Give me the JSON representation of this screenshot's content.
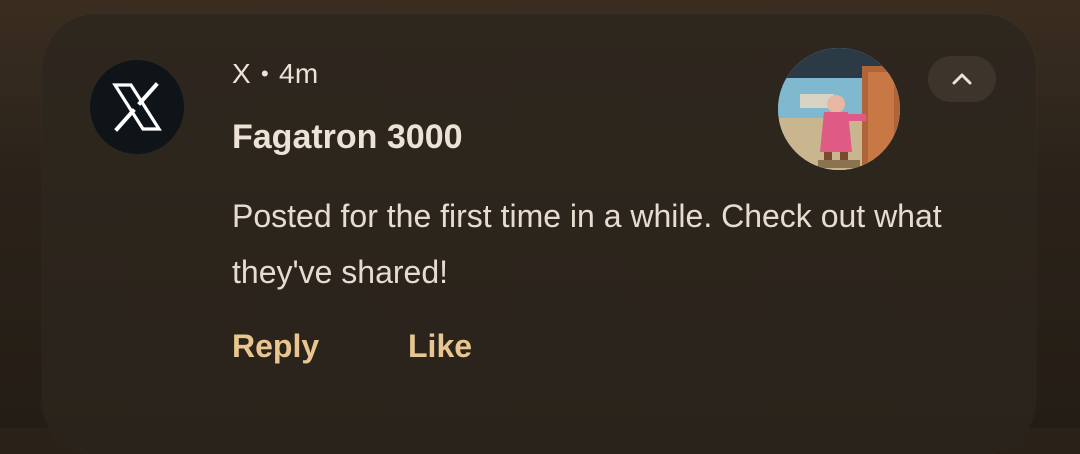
{
  "notification": {
    "app_name": "X",
    "separator": "•",
    "time_ago": "4m",
    "title": "Fagatron 3000",
    "body": "Posted for the first time in a while. Check out what they've shared!",
    "app_icon": "x-logo-icon",
    "expand_icon": "chevron-up-icon",
    "actions": [
      {
        "label": "Reply"
      },
      {
        "label": "Like"
      }
    ]
  },
  "colors": {
    "card_background": "#2e271e",
    "action_text": "#e9c690",
    "primary_text": "#ece3d6",
    "app_icon_background": "#0f1419"
  }
}
